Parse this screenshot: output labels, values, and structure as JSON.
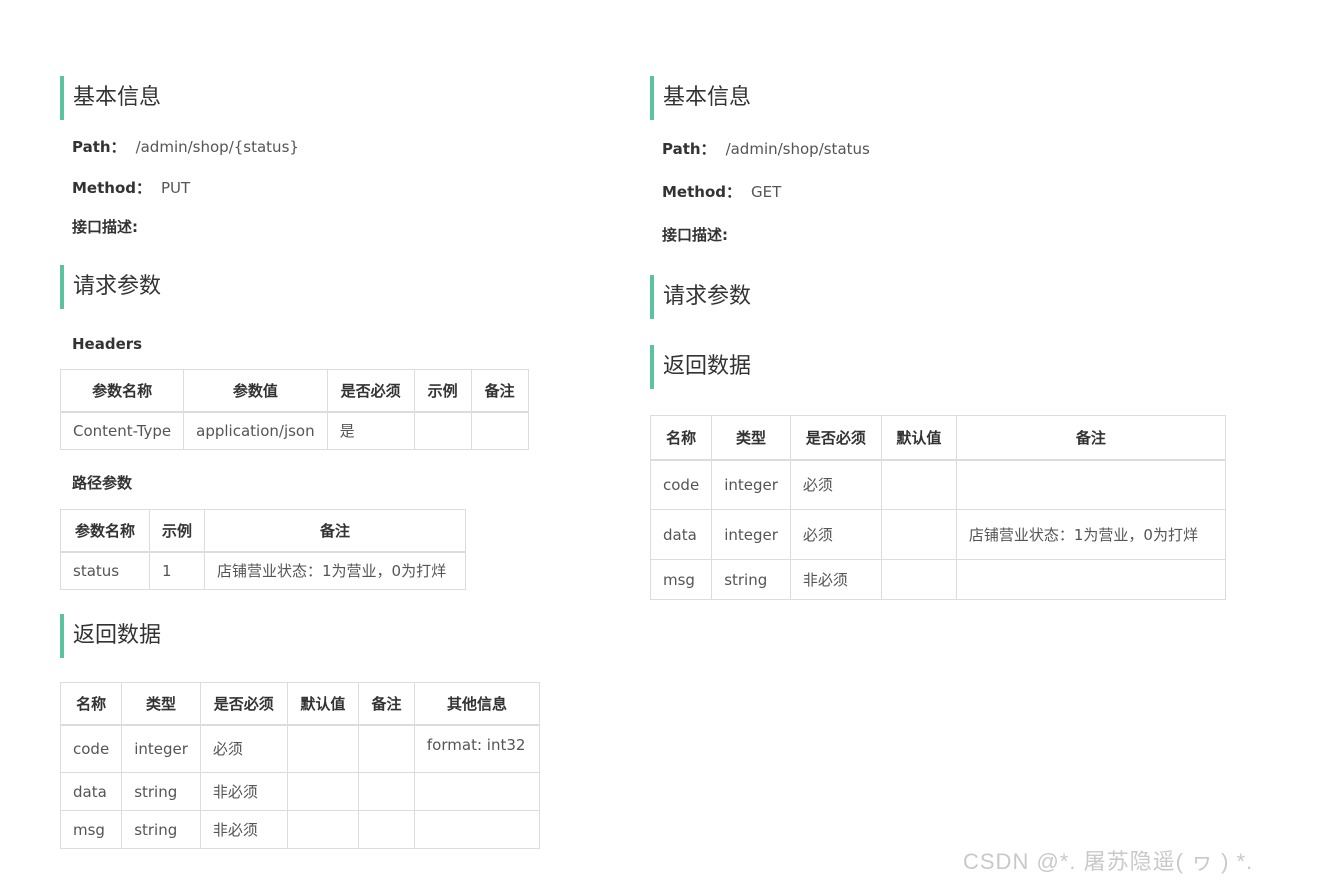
{
  "left": {
    "basic_title": "基本信息",
    "path_label": "Path：",
    "path_value": "/admin/shop/{status}",
    "method_label": "Method：",
    "method_value": "PUT",
    "desc_label": "接口描述:",
    "request_title": "请求参数",
    "headers_label": "Headers",
    "headers_table": {
      "columns": [
        "参数名称",
        "参数值",
        "是否必须",
        "示例",
        "备注"
      ],
      "rows": [
        [
          "Content-Type",
          "application/json",
          "是",
          "",
          ""
        ]
      ]
    },
    "path_params_label": "路径参数",
    "path_params_table": {
      "columns": [
        "参数名称",
        "示例",
        "备注"
      ],
      "rows": [
        [
          "status",
          "1",
          "店铺营业状态：1为营业，0为打烊"
        ]
      ]
    },
    "response_title": "返回数据",
    "response_table": {
      "columns": [
        "名称",
        "类型",
        "是否必须",
        "默认值",
        "备注",
        "其他信息"
      ],
      "rows": [
        [
          "code",
          "integer",
          "必须",
          "",
          "",
          "format: int32"
        ],
        [
          "data",
          "string",
          "非必须",
          "",
          "",
          ""
        ],
        [
          "msg",
          "string",
          "非必须",
          "",
          "",
          ""
        ]
      ]
    }
  },
  "right": {
    "basic_title": "基本信息",
    "path_label": "Path：",
    "path_value": "/admin/shop/status",
    "method_label": "Method：",
    "method_value": "GET",
    "desc_label": "接口描述:",
    "request_title": "请求参数",
    "response_title": "返回数据",
    "response_table": {
      "columns": [
        "名称",
        "类型",
        "是否必须",
        "默认值",
        "备注"
      ],
      "rows": [
        [
          "code",
          "integer",
          "必须",
          "",
          ""
        ],
        [
          "data",
          "integer",
          "必须",
          "",
          "店铺营业状态：1为营业，0为打烊"
        ],
        [
          "msg",
          "string",
          "非必须",
          "",
          ""
        ]
      ]
    }
  },
  "watermark": "CSDN @*. 屠苏隐遥(  ヮ  ) *.",
  "colors": {
    "accent": "#5cc3a1",
    "border": "#dcdcdc"
  }
}
